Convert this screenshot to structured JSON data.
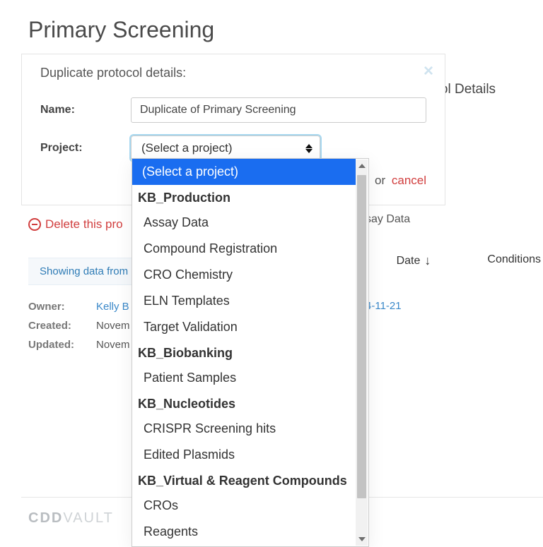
{
  "page": {
    "title": "Primary Screening"
  },
  "background": {
    "protocol_details_label": "Protocol Details",
    "assay_partial": "say Data",
    "table": {
      "date_label": "Date",
      "conditions_label": "Conditions"
    },
    "link_date": "4-11-21",
    "delete_text": "Delete this pro",
    "showing_text": "Showing data from",
    "meta": {
      "owner_label": "Owner:",
      "owner_value": "Kelly B",
      "created_label": "Created:",
      "created_value": "Novem",
      "updated_label": "Updated:",
      "updated_value": "Novem"
    }
  },
  "modal": {
    "title": "Duplicate protocol details:",
    "name_label": "Name:",
    "name_value": "Duplicate of Primary Screening",
    "project_label": "Project:",
    "project_placeholder": "(Select a project)",
    "or_text": "or",
    "cancel_text": "cancel"
  },
  "dropdown": {
    "placeholder": "(Select a project)",
    "groups": [
      {
        "title": "KB_Production",
        "items": [
          "Assay Data",
          "Compound Registration",
          "CRO Chemistry",
          "ELN Templates",
          "Target Validation"
        ]
      },
      {
        "title": "KB_Biobanking",
        "items": [
          "Patient Samples"
        ]
      },
      {
        "title": "KB_Nucleotides",
        "items": [
          "CRISPR Screening hits",
          "Edited Plasmids"
        ]
      },
      {
        "title": "KB_Virtual & Reagent Compounds",
        "items": [
          "CROs",
          "Reagents"
        ]
      }
    ]
  },
  "footer": {
    "brand_bold": "CDD",
    "brand_light": "VAULT"
  }
}
